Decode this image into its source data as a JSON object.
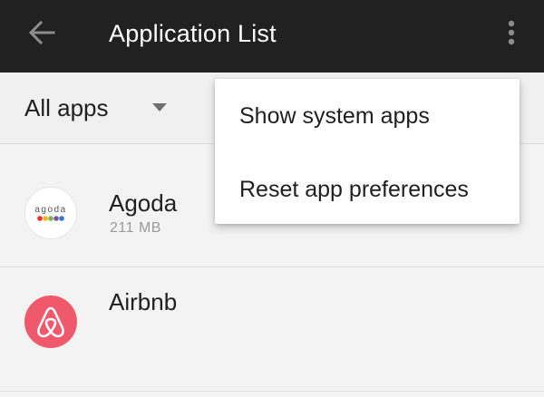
{
  "appbar": {
    "title": "Application List",
    "back_icon": "arrow-left",
    "overflow_icon": "more-vertical",
    "background": "#212121"
  },
  "filter": {
    "selected": "All apps",
    "icon": "caret-down"
  },
  "apps": [
    {
      "name": "Agoda",
      "size": "211 MB",
      "icon": {
        "wordmark": "agoda",
        "dot_colors": [
          "#e6322b",
          "#f6b12c",
          "#7ab648",
          "#8a4a9e",
          "#2b7cd3"
        ]
      }
    },
    {
      "name": "Airbnb",
      "icon": {
        "color": "#f0586c"
      }
    }
  ],
  "overflow_menu": {
    "items": [
      {
        "label": "Show system apps"
      },
      {
        "label": "Reset app preferences"
      }
    ]
  }
}
